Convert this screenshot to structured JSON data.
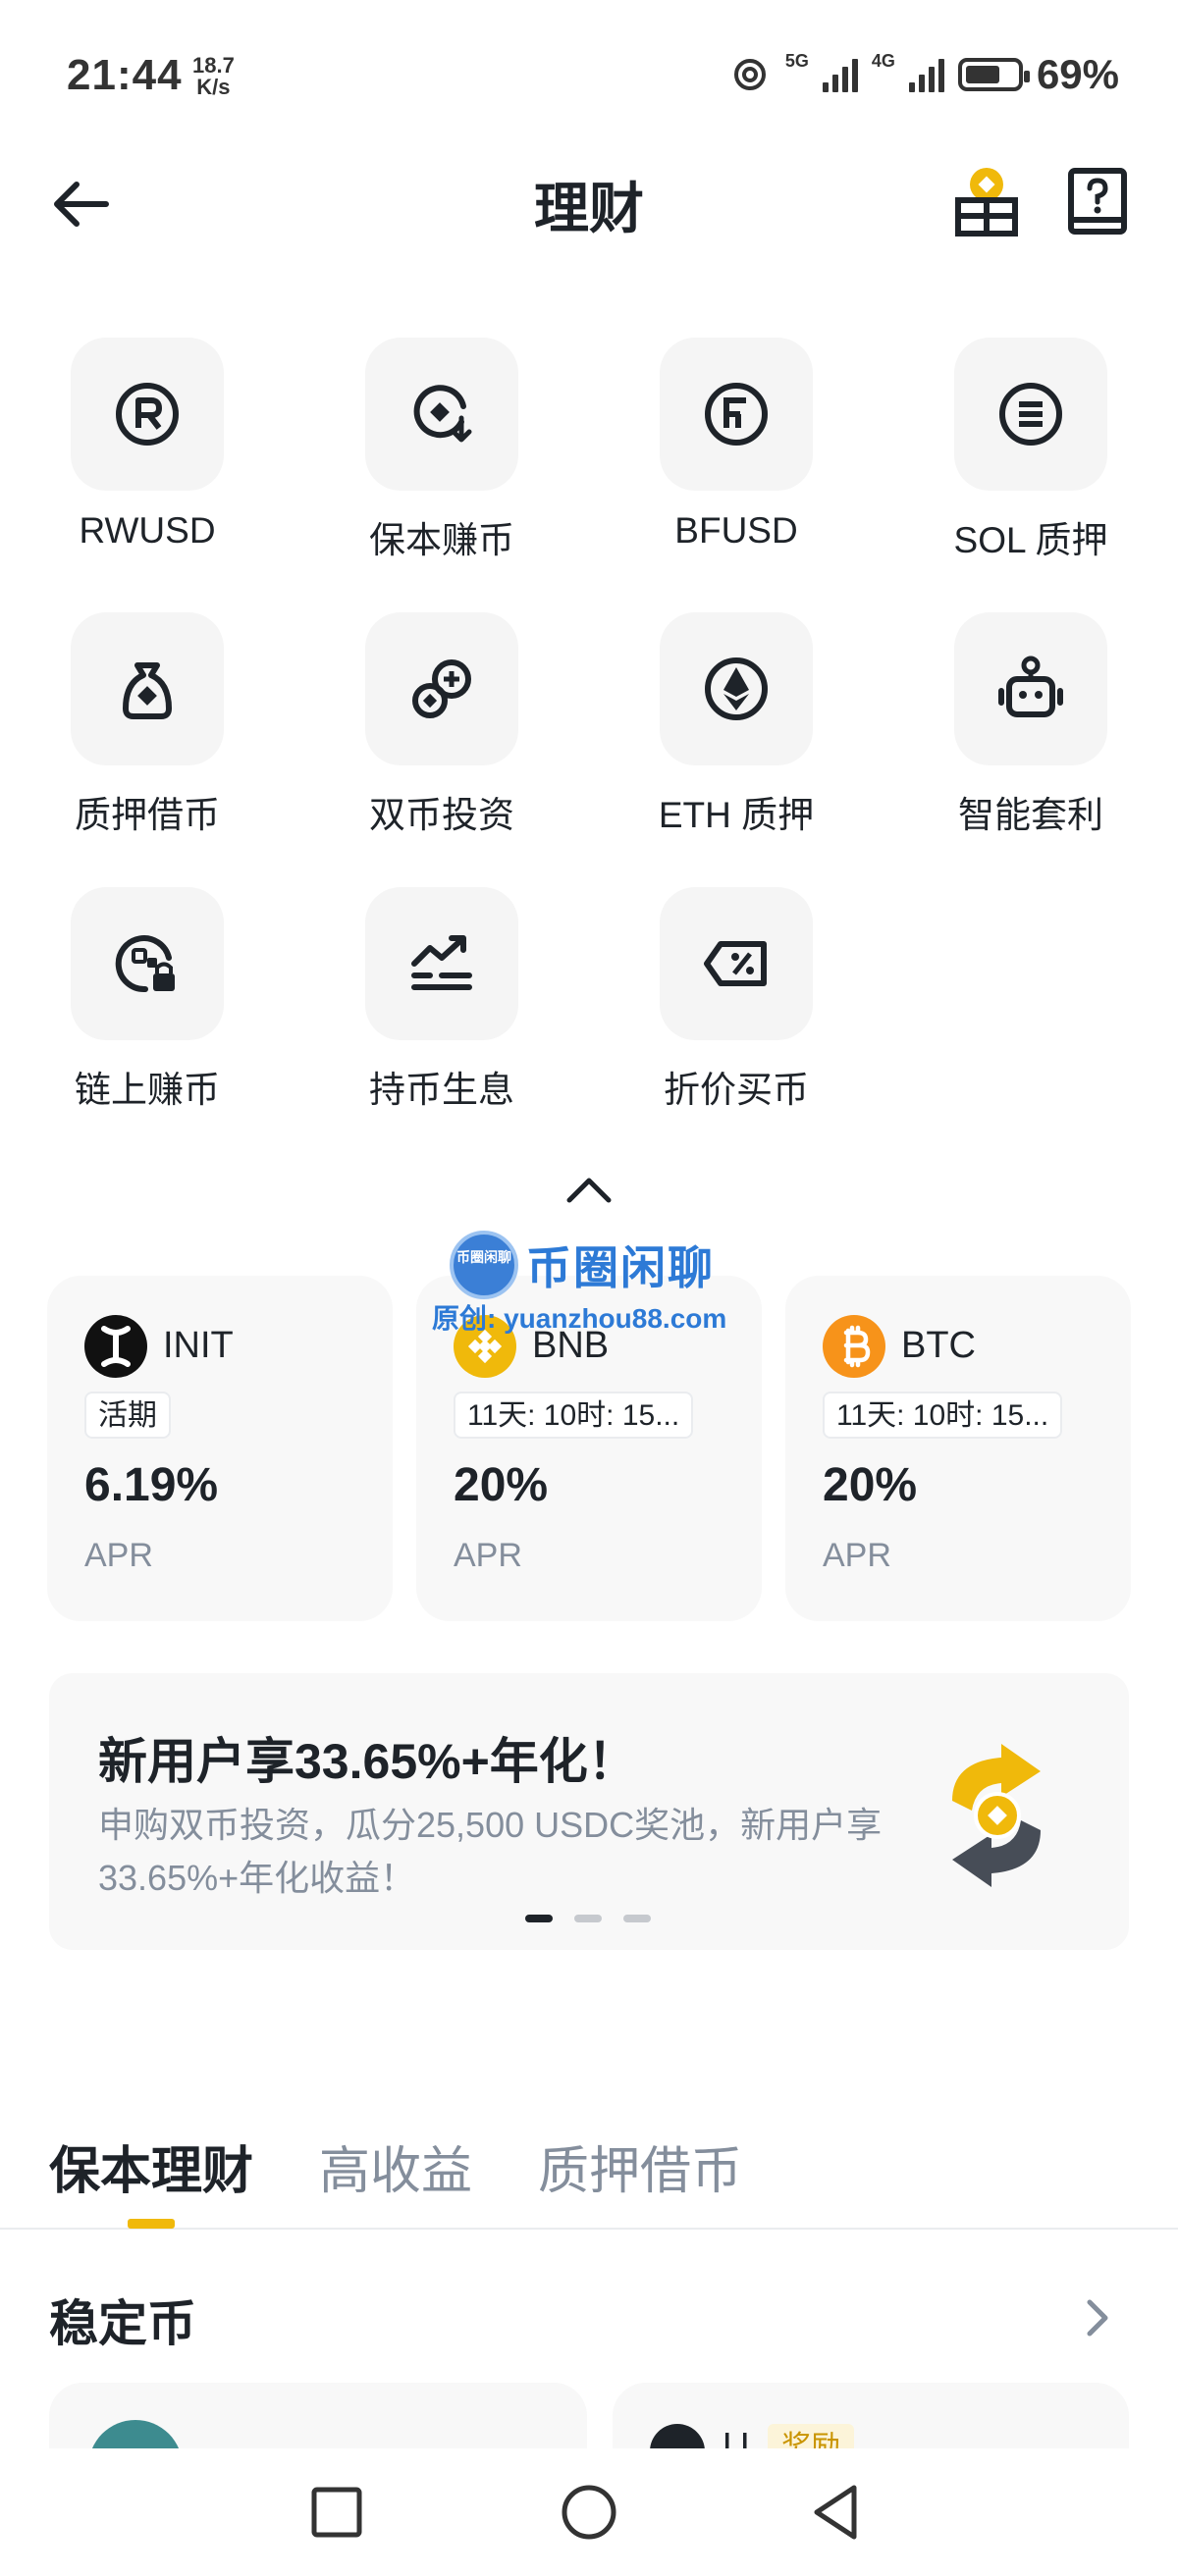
{
  "status": {
    "time": "21:44",
    "speed_value": "18.7",
    "speed_unit": "K/s",
    "net1": "5G",
    "net2": "4G",
    "battery": "69%",
    "battery_level": 0.69
  },
  "header": {
    "title": "理财",
    "back_icon": "arrow-left-icon",
    "gift_icon": "gift-box-icon",
    "help_icon": "help-book-icon"
  },
  "features": [
    {
      "label": "RWUSD",
      "icon": "rwusd-icon"
    },
    {
      "label": "保本赚币",
      "icon": "principal-earn-icon"
    },
    {
      "label": "BFUSD",
      "icon": "bfusd-icon"
    },
    {
      "label": "SOL 质押",
      "icon": "sol-staking-icon"
    },
    {
      "label": "质押借币",
      "icon": "loan-bag-icon"
    },
    {
      "label": "双币投资",
      "icon": "dual-investment-icon"
    },
    {
      "label": "ETH 质押",
      "icon": "eth-staking-icon"
    },
    {
      "label": "智能套利",
      "icon": "robot-icon"
    },
    {
      "label": "链上赚币",
      "icon": "onchain-earn-icon"
    },
    {
      "label": "持币生息",
      "icon": "hold-interest-icon"
    },
    {
      "label": "折价买币",
      "icon": "discount-ticket-icon"
    }
  ],
  "products": [
    {
      "coin": "INIT",
      "tag": "活期",
      "value": "6.19%",
      "sub": "APR",
      "color": "#111111"
    },
    {
      "coin": "BNB",
      "tag": "11天: 10时: 15...",
      "value": "20%",
      "sub": "APR",
      "color": "#f0b90b"
    },
    {
      "coin": "BTC",
      "tag": "11天: 10时: 15...",
      "value": "20%",
      "sub": "APR",
      "color": "#f7931a"
    }
  ],
  "watermark": {
    "badge": "币圈闲聊",
    "title": "币圈闲聊",
    "url": "原创: yuanzhou88.com"
  },
  "banner": {
    "title": "新用户享33.65%+年化！",
    "desc": "申购双币投资，瓜分25,500 USDC奖池，新用户享33.65%+年化收益！",
    "page_count": 3,
    "active_page": 1
  },
  "tabs": [
    {
      "label": "保本理财",
      "active": true
    },
    {
      "label": "高收益",
      "active": false
    },
    {
      "label": "质押借币",
      "active": false
    }
  ],
  "section": {
    "title": "稳定币"
  },
  "mini_cards": [
    {
      "label": ""
    },
    {
      "label": "U",
      "badge": "奖励"
    }
  ],
  "colors": {
    "accent": "#f0b90b",
    "text": "#1e2329",
    "muted": "#848e9c",
    "card_bg": "#f8f8f8"
  }
}
